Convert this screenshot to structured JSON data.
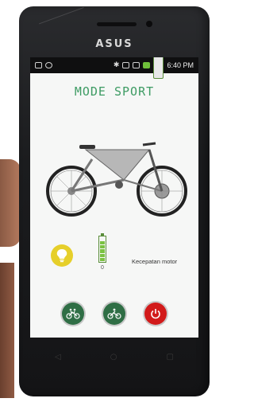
{
  "device": {
    "brand": "ASUS"
  },
  "status_bar": {
    "time": "6:40 PM",
    "left_icons": [
      "message-icon",
      "whatsapp-icon"
    ],
    "right_icons": [
      "bluetooth-icon",
      "nfc-icon",
      "screenshot-icon",
      "signal-icon",
      "battery-icon"
    ]
  },
  "app": {
    "title": "MODE SPORT",
    "accent_color": "#3d9b63",
    "battery": {
      "value_label": "0",
      "level_fraction": 0.83
    },
    "speed_label": "Kecepatan motor",
    "buttons": [
      {
        "name": "tandem-bike-button",
        "icon": "tandem-bike-icon",
        "color": "#2f6e45"
      },
      {
        "name": "cyclist-button",
        "icon": "cyclist-icon",
        "color": "#2f6e45"
      },
      {
        "name": "power-button",
        "icon": "power-icon",
        "color": "#d21a1a"
      }
    ]
  },
  "navigation": {
    "icons": [
      "back-icon",
      "home-icon",
      "recent-apps-icon"
    ]
  }
}
